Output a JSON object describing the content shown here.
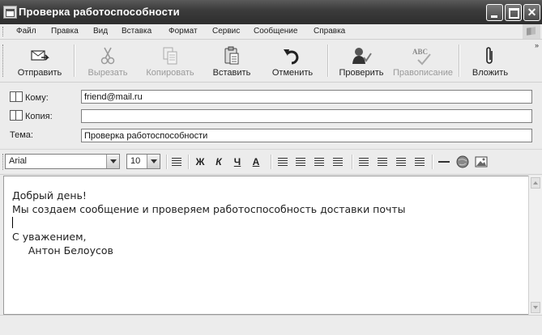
{
  "window": {
    "title": "Проверка работоспособности"
  },
  "menu": [
    "Файл",
    "Правка",
    "Вид",
    "Вставка",
    "Формат",
    "Сервис",
    "Сообщение",
    "Справка"
  ],
  "toolbar": {
    "send": "Отправить",
    "cut": "Вырезать",
    "copy": "Копировать",
    "paste": "Вставить",
    "undo": "Отменить",
    "check": "Проверить",
    "spelling": "Правописание",
    "attach": "Вложить",
    "more": "»",
    "spell_icon_text": "ABC"
  },
  "fields": {
    "to_label": "Кому:",
    "to_value": "friend@mail.ru",
    "cc_label": "Копия:",
    "cc_value": "",
    "subject_label": "Тема:",
    "subject_value": "Проверка работоспособности"
  },
  "format": {
    "font": "Arial",
    "size": "10",
    "bold": "Ж",
    "italic": "К",
    "underline": "Ч",
    "font_color": "А"
  },
  "message": {
    "lines": [
      "Добрый день!",
      "Мы создаем сообщение и проверяем работоспособность доставки почты",
      "",
      "С уважением,",
      "     Антон Белоусов"
    ]
  }
}
